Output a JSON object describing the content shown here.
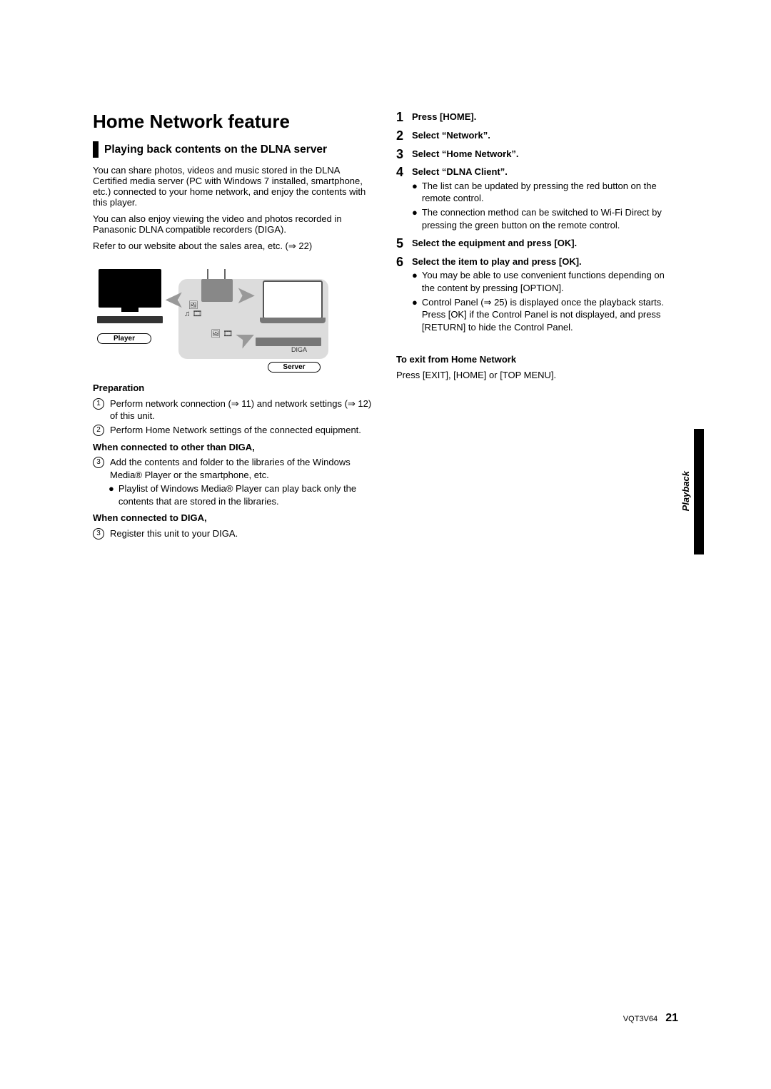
{
  "title": "Home Network feature",
  "section_title": "Playing back contents on the DLNA server",
  "intro": {
    "p1": "You can share photos, videos and music stored in the DLNA Certified media server (PC with Windows 7 installed, smartphone, etc.) connected to your home network, and enjoy the contents with this player.",
    "p2": "You can also enjoy viewing the video and photos recorded in Panasonic DLNA compatible recorders (DIGA).",
    "p3": "Refer to our website about the sales area, etc. (⇒ 22)"
  },
  "diagram": {
    "player_label": "Player",
    "server_label": "Server",
    "diga_label": "DIGA"
  },
  "prep_heading": "Preparation",
  "prep": {
    "i1": "Perform network connection (⇒ 11) and network settings (⇒ 12) of this unit.",
    "i2": "Perform Home Network settings of the connected equipment."
  },
  "other_than_diga_heading": "When connected to other than DIGA,",
  "other_than_diga": {
    "i3": "Add the contents and folder to the libraries of the Windows Media® Player or the smartphone, etc.",
    "bullet": "Playlist of Windows Media® Player can play back only the contents that are stored in the libraries."
  },
  "to_diga_heading": "When connected to DIGA,",
  "to_diga": {
    "i3": "Register this unit to your DIGA."
  },
  "steps": {
    "s1": "Press [HOME].",
    "s2": "Select “Network”.",
    "s3": "Select “Home Network”.",
    "s4": "Select “DLNA Client”.",
    "s4_b1": "The list can be updated by pressing the red button on the remote control.",
    "s4_b2": "The connection method can be switched to Wi-Fi Direct by pressing the green button on the remote control.",
    "s5": "Select the equipment and press [OK].",
    "s6": "Select the item to play and press [OK].",
    "s6_b1": "You may be able to use convenient functions depending on the content by pressing [OPTION].",
    "s6_b2": "Control Panel (⇒ 25) is displayed once the playback starts. Press [OK] if the Control Panel is not displayed, and press [RETURN] to hide the Control Panel."
  },
  "exit": {
    "heading": "To exit from Home Network",
    "body": "Press [EXIT], [HOME] or [TOP MENU]."
  },
  "side_tab": "Playback",
  "footer": {
    "code": "VQT3V64",
    "page": "21"
  }
}
